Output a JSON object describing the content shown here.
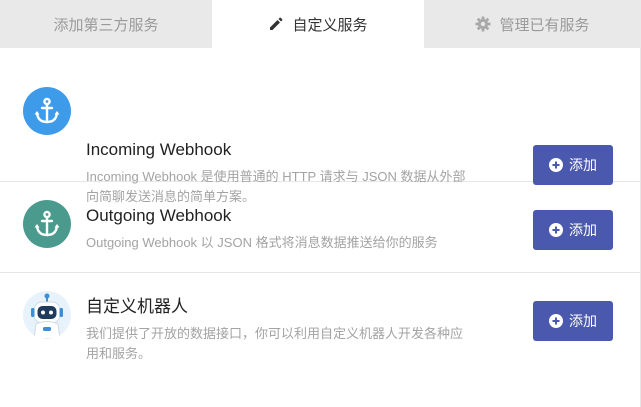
{
  "tabs": [
    {
      "label": "添加第三方服务",
      "icon": "none",
      "active": false
    },
    {
      "label": "自定义服务",
      "icon": "pencil-icon",
      "active": true
    },
    {
      "label": "管理已有服务",
      "icon": "gear-icon",
      "active": false
    }
  ],
  "services": [
    {
      "title": "Incoming Webhook",
      "description": "Incoming Webhook 是使用普通的 HTTP 请求与 JSON 数据从外部向简聊发送消息的简单方案。",
      "icon": "anchor-icon",
      "icon_bg": "#3d9be9",
      "button_label": "添加"
    },
    {
      "title": "Outgoing Webhook",
      "description": "Outgoing Webhook 以 JSON 格式将消息数据推送给你的服务",
      "icon": "anchor-icon",
      "icon_bg": "#4a9a8d",
      "button_label": "添加"
    },
    {
      "title": "自定义机器人",
      "description": "我们提供了开放的数据接口，你可以利用自定义机器人开发各种应用和服务。",
      "icon": "robot-icon",
      "icon_bg": "#e8f2fb",
      "button_label": "添加"
    }
  ],
  "colors": {
    "accent": "#4a58ae",
    "tab_bg": "#e9e9e9",
    "muted_text": "#a3a3a3"
  }
}
